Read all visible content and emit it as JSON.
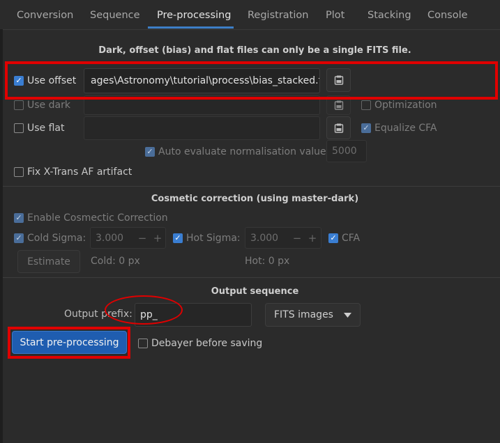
{
  "tabs": [
    {
      "label": "Conversion",
      "active": false
    },
    {
      "label": "Sequence",
      "active": false
    },
    {
      "label": "Pre-processing",
      "active": true
    },
    {
      "label": "Registration",
      "active": false
    },
    {
      "label": "Plot",
      "active": false
    },
    {
      "label": "Stacking",
      "active": false
    },
    {
      "label": "Console",
      "active": false
    }
  ],
  "calibration": {
    "note": "Dark, offset (bias) and flat files can only be a single FITS file.",
    "use_offset": {
      "label": "Use offset",
      "checked": true,
      "value": "ages\\Astronomy\\tutorial\\process\\bias_stacked.fit"
    },
    "use_dark": {
      "label": "Use dark",
      "checked": false,
      "value": ""
    },
    "optimization": {
      "label": "Optimization",
      "checked": false
    },
    "use_flat": {
      "label": "Use flat",
      "checked": false,
      "value": ""
    },
    "equalize_cfa": {
      "label": "Equalize CFA",
      "checked": true
    },
    "auto_eval": {
      "label": "Auto evaluate normalisation value",
      "checked": true,
      "value": "5000"
    },
    "fix_xtrans": {
      "label": "Fix X-Trans AF artifact",
      "checked": false
    }
  },
  "cosmetic": {
    "title": "Cosmetic correction (using master-dark)",
    "enable": {
      "label": "Enable Cosmectic Correction",
      "checked": true
    },
    "cold_sigma": {
      "label": "Cold Sigma:",
      "checked": true,
      "value": "3.000"
    },
    "hot_sigma": {
      "label": "Hot Sigma:",
      "checked": true,
      "value": "3.000"
    },
    "cfa": {
      "label": "CFA",
      "checked": true
    },
    "estimate_label": "Estimate",
    "cold_px": "Cold: 0 px",
    "hot_px": "Hot: 0 px",
    "minus": "−",
    "plus": "+"
  },
  "output": {
    "title": "Output sequence",
    "prefix_label": "Output prefix:",
    "prefix_value": "pp_",
    "format": "FITS images",
    "start_label": "Start pre-processing",
    "debayer": {
      "label": "Debayer before saving",
      "checked": false
    }
  },
  "colors": {
    "accent": "#3d7fc7",
    "primary_button": "#1f5db0",
    "annotation": "#e00000"
  }
}
